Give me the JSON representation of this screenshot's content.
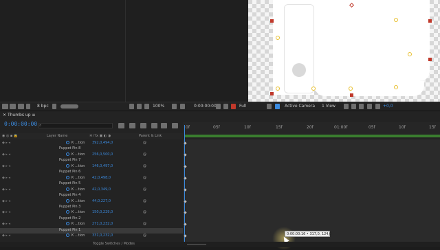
{
  "colors": {
    "accent": "#3b8be0",
    "work_area": "#3a7d2f",
    "pin": "#e8c030",
    "pin_handle": "#c0392b"
  },
  "viewer_toolbar": {
    "zoom": "100%",
    "time": "0:00:00:00",
    "resolution": "Full",
    "camera": "Active Camera",
    "view": "1 View",
    "exposure": "+0,0",
    "bits": "8 bpc"
  },
  "timeline": {
    "tab_label": "Thumbs up",
    "timecode": "0:00:00:00",
    "header": {
      "layer_name": "Layer Name",
      "parent": "Parent & Link"
    },
    "ruler_ticks": [
      "0f",
      "05f",
      "10f",
      "15f",
      "20f",
      "01:00f",
      "05f",
      "10f",
      "15f"
    ],
    "rows": [
      {
        "type": "value",
        "name": "Ꮶ ...tion",
        "value": "392,0,494,0"
      },
      {
        "type": "pin",
        "name": "Puppet Pin 8"
      },
      {
        "type": "value",
        "name": "Ꮶ ...tion",
        "value": "256,0,500,0"
      },
      {
        "type": "pin",
        "name": "Puppet Pin 7"
      },
      {
        "type": "value",
        "name": "Ꮶ ...tion",
        "value": "146,0,497,0"
      },
      {
        "type": "pin",
        "name": "Puppet Pin 6"
      },
      {
        "type": "value",
        "name": "Ꮶ ...tion",
        "value": "42,0,498,0"
      },
      {
        "type": "pin",
        "name": "Puppet Pin 5"
      },
      {
        "type": "value",
        "name": "Ꮶ ...tion",
        "value": "42,0,349,0"
      },
      {
        "type": "pin",
        "name": "Puppet Pin 4"
      },
      {
        "type": "value",
        "name": "Ꮶ ...tion",
        "value": "44,0,227,0"
      },
      {
        "type": "pin",
        "name": "Puppet Pin 3"
      },
      {
        "type": "value",
        "name": "Ꮶ ...tion",
        "value": "150,0,229,0"
      },
      {
        "type": "pin",
        "name": "Puppet Pin 2"
      },
      {
        "type": "value",
        "name": "Ꮶ ...tion",
        "value": "271,0,232,0"
      },
      {
        "type": "pin",
        "name": "Puppet Pin 1"
      },
      {
        "type": "value",
        "name": "Ꮶ ...tion",
        "value": "331,0,232,0"
      }
    ],
    "footer_label": "Toggle Switches / Modes",
    "tooltip": "0:00:00:16 • 317,0, 124,0"
  }
}
